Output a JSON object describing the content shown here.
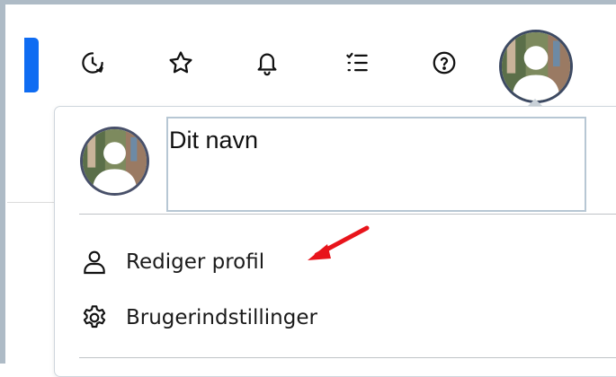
{
  "topbar": {
    "icons": [
      "recent-history-icon",
      "star-icon",
      "bell-icon",
      "checklist-icon",
      "help-icon"
    ],
    "accent_color": "#0f6cf2"
  },
  "account_menu": {
    "name_placeholder": "Dit navn",
    "items": [
      {
        "label": "Rediger profil",
        "icon": "person-icon"
      },
      {
        "label": "Brugerindstillinger",
        "icon": "gear-icon"
      }
    ],
    "annotation_arrow_color": "#e8141b"
  }
}
